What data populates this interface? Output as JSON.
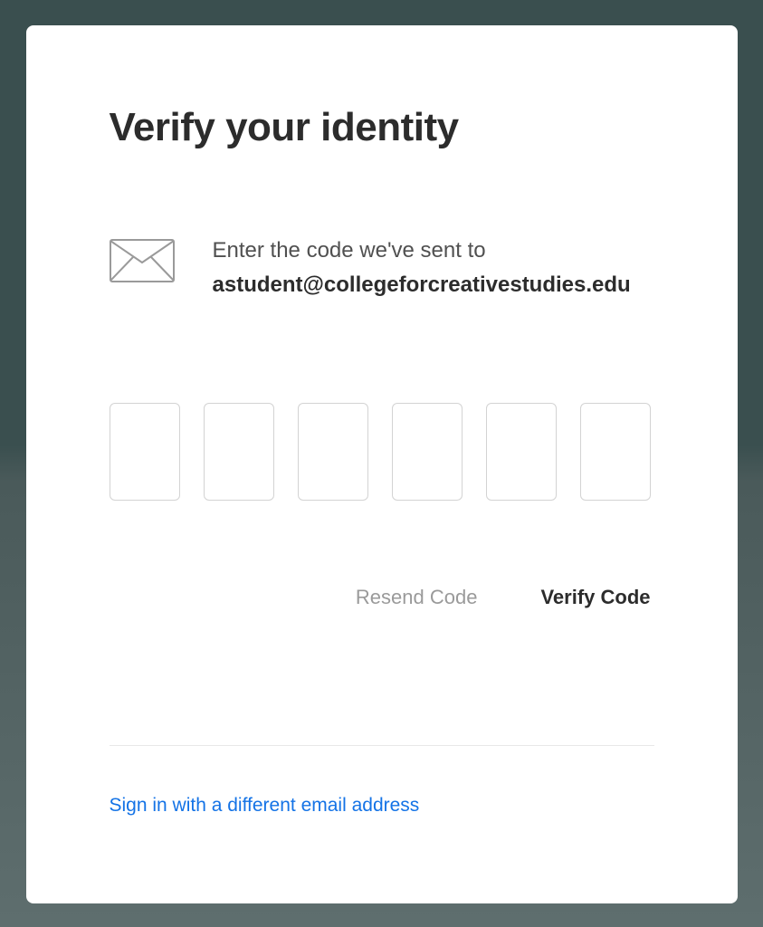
{
  "heading": "Verify your identity",
  "instruction_prefix": "Enter the code we've sent to",
  "email": "astudent@collegeforcreativestudies.edu",
  "buttons": {
    "resend": "Resend Code",
    "verify": "Verify Code"
  },
  "alt_link": "Sign in with a different email address"
}
